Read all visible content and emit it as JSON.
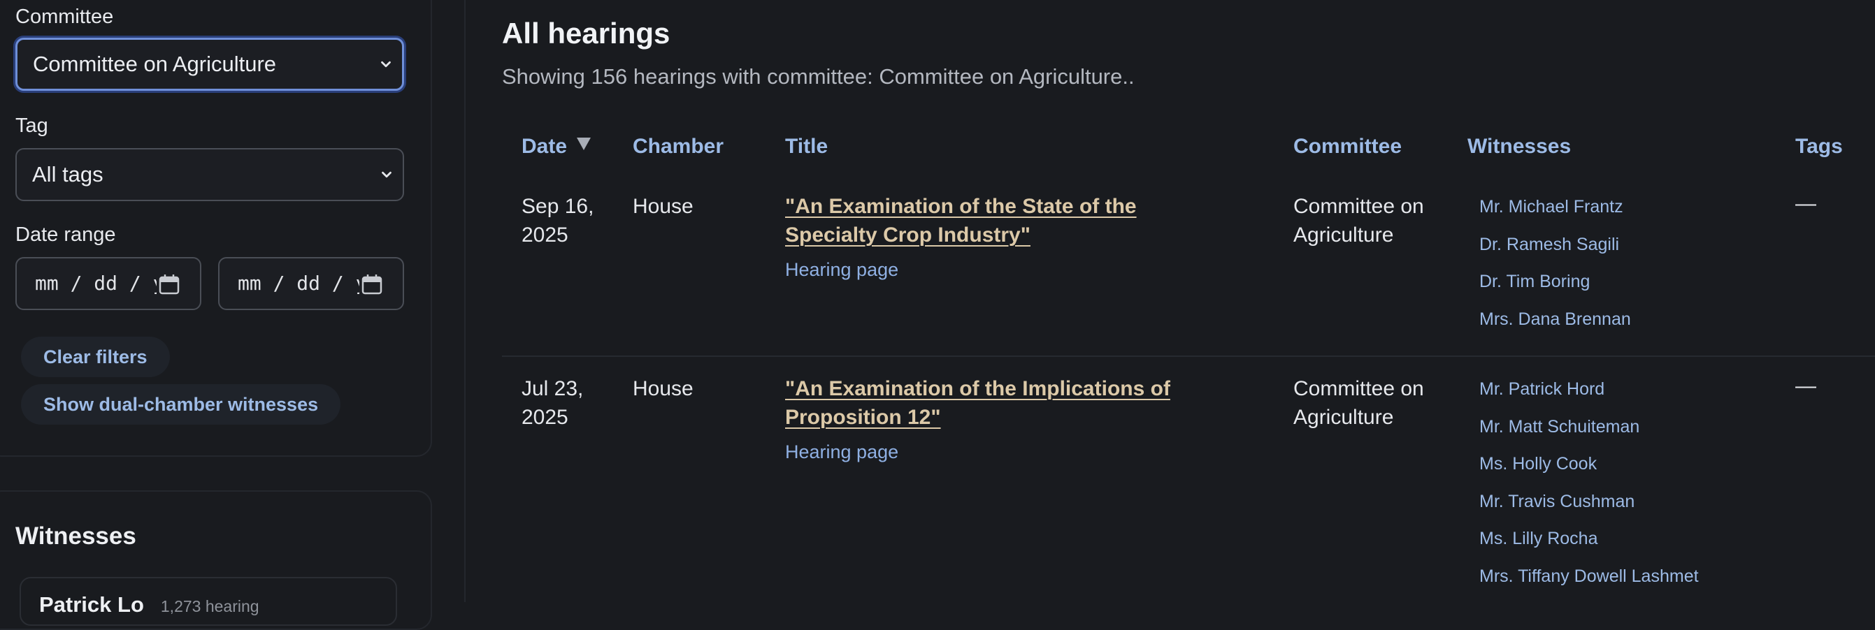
{
  "filters": {
    "committee_label": "Committee",
    "committee_value": "Committee on Agriculture",
    "tag_label": "Tag",
    "tag_value": "All tags",
    "date_range_label": "Date range",
    "date_start_placeholder": "mm / dd / yyyy",
    "date_end_placeholder": "mm / dd / yyyy",
    "clear_filters_label": "Clear filters",
    "dual_chamber_label": "Show dual-chamber witnesses"
  },
  "witnesses_panel": {
    "title": "Witnesses",
    "first_item_name": "Patrick Lo",
    "first_item_meta": "1,273 hearing"
  },
  "main": {
    "title": "All hearings",
    "subtitle": "Showing 156 hearings with committee: Committee on Agriculture..",
    "columns": {
      "date": "Date",
      "chamber": "Chamber",
      "title": "Title",
      "committee": "Committee",
      "witnesses": "Witnesses",
      "tags": "Tags"
    },
    "rows": [
      {
        "date_line1": "Sep 16,",
        "date_line2": "2025",
        "chamber": "House",
        "title": "\"An Examination of the State of the Specialty Crop Industry\"",
        "hearing_page": "Hearing page",
        "committee_line1": "Committee on",
        "committee_line2": "Agriculture",
        "witnesses": [
          "Mr. Michael Frantz",
          "Dr. Ramesh Sagili",
          "Dr. Tim Boring",
          "Mrs. Dana Brennan"
        ],
        "tags": "—"
      },
      {
        "date_line1": "Jul 23,",
        "date_line2": "2025",
        "chamber": "House",
        "title": "\"An Examination of the Implications of Proposition 12\"",
        "hearing_page": "Hearing page",
        "committee_line1": "Committee on",
        "committee_line2": "Agriculture",
        "witnesses": [
          "Mr. Patrick Hord",
          "Mr. Matt Schuiteman",
          "Ms. Holly Cook",
          "Mr. Travis Cushman",
          "Ms. Lilly Rocha",
          "Mrs. Tiffany Dowell Lashmet"
        ],
        "tags": "—"
      }
    ]
  },
  "colors": {
    "background": "#191b1f",
    "accent_link": "#9dbbe6",
    "title_link": "#dcc9a8",
    "focus_ring": "#6f8fd8"
  },
  "icons": {
    "select_chevron": "chevron-down-icon",
    "date_picker": "calendar-icon",
    "sort": "sort-descending-icon"
  }
}
